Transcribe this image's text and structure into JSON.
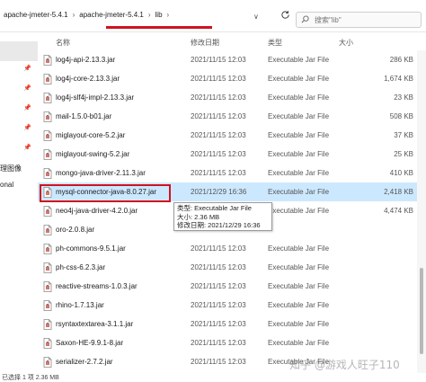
{
  "breadcrumb": {
    "items": [
      "apache-jmeter-5.4.1",
      "apache-jmeter-5.4.1",
      "lib"
    ],
    "separator": "›",
    "dropdown": "∨"
  },
  "search": {
    "placeholder": "搜索\"lib\""
  },
  "columns": {
    "name": "名称",
    "date": "修改日期",
    "type": "类型",
    "size": "大小"
  },
  "nav": [
    {
      "label": ""
    },
    {
      "label": ""
    },
    {
      "label": ""
    },
    {
      "label": ""
    },
    {
      "label": ""
    },
    {
      "label": ""
    },
    {
      "label": "理图像"
    },
    {
      "label": ""
    },
    {
      "label": "onal"
    }
  ],
  "files": [
    {
      "name": "log4j-api-2.13.3.jar",
      "date": "2021/11/15 12:03",
      "type": "Executable Jar File",
      "size": "286 KB"
    },
    {
      "name": "log4j-core-2.13.3.jar",
      "date": "2021/11/15 12:03",
      "type": "Executable Jar File",
      "size": "1,674 KB"
    },
    {
      "name": "log4j-slf4j-impl-2.13.3.jar",
      "date": "2021/11/15 12:03",
      "type": "Executable Jar File",
      "size": "23 KB"
    },
    {
      "name": "mail-1.5.0-b01.jar",
      "date": "2021/11/15 12:03",
      "type": "Executable Jar File",
      "size": "508 KB"
    },
    {
      "name": "miglayout-core-5.2.jar",
      "date": "2021/11/15 12:03",
      "type": "Executable Jar File",
      "size": "37 KB"
    },
    {
      "name": "miglayout-swing-5.2.jar",
      "date": "2021/11/15 12:03",
      "type": "Executable Jar File",
      "size": "25 KB"
    },
    {
      "name": "mongo-java-driver-2.11.3.jar",
      "date": "2021/11/15 12:03",
      "type": "Executable Jar File",
      "size": "410 KB"
    },
    {
      "name": "mysql-connector-java-8.0.27.jar",
      "date": "2021/12/29 16:36",
      "type": "Executable Jar File",
      "size": "2,418 KB"
    },
    {
      "name": "neo4j-java-driver-4.2.0.jar",
      "date": "2021/11/15 12:03",
      "type": "Executable Jar File",
      "size": "4,474 KB"
    },
    {
      "name": "oro-2.0.8.jar",
      "date": "",
      "type": "",
      "size": ""
    },
    {
      "name": "ph-commons-9.5.1.jar",
      "date": "2021/11/15 12:03",
      "type": "Executable Jar File",
      "size": ""
    },
    {
      "name": "ph-css-6.2.3.jar",
      "date": "2021/11/15 12:03",
      "type": "Executable Jar File",
      "size": ""
    },
    {
      "name": "reactive-streams-1.0.3.jar",
      "date": "2021/11/15 12:03",
      "type": "Executable Jar File",
      "size": ""
    },
    {
      "name": "rhino-1.7.13.jar",
      "date": "2021/11/15 12:03",
      "type": "Executable Jar File",
      "size": ""
    },
    {
      "name": "rsyntaxtextarea-3.1.1.jar",
      "date": "2021/11/15 12:03",
      "type": "Executable Jar File",
      "size": ""
    },
    {
      "name": "Saxon-HE-9.9.1-8.jar",
      "date": "2021/11/15 12:03",
      "type": "Executable Jar File",
      "size": ""
    },
    {
      "name": "serializer-2.7.2.jar",
      "date": "2021/11/15 12:03",
      "type": "Executable Jar File",
      "size": ""
    }
  ],
  "tooltip": {
    "type_line": "类型: Executable Jar File",
    "size_line": "大小: 2.36 MB",
    "date_line": "修改日期: 2021/12/29 16:36"
  },
  "status": {
    "text": "已选择 1 项  2.36 MB"
  },
  "watermark": {
    "text": "知乎 @游戏人旺子110"
  },
  "colors": {
    "accent_red": "#d0131f",
    "selection": "#cce8ff"
  },
  "icons": {
    "refresh": "refresh-icon",
    "search": "search-icon",
    "jar": "jar-file-icon",
    "pin": "pin-icon"
  }
}
